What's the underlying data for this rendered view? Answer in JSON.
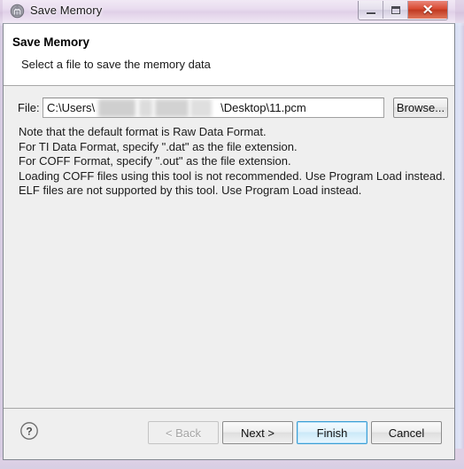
{
  "titlebar": {
    "icon": "app-icon",
    "title": "Save Memory",
    "minimize_label": "Minimize",
    "maximize_label": "Maximize",
    "close_label": "Close"
  },
  "header": {
    "title": "Save Memory",
    "subtitle": "Select a file to save the memory data"
  },
  "form": {
    "file_label": "File:",
    "file_value_prefix": "C:\\Users\\",
    "file_value_suffix": "\\Desktop\\11.pcm",
    "file_placeholder": "",
    "browse_label": "Browse..."
  },
  "notes": [
    "Note that the default format is Raw Data Format.",
    "For TI Data Format, specify \".dat\" as the file extension.",
    "For COFF Format, specify \".out\" as the file extension.",
    "Loading COFF files using this tool is not recommended. Use Program Load instead.",
    "ELF files are not supported by this tool. Use Program Load instead."
  ],
  "footer": {
    "help_label": "?",
    "back_label": "< Back",
    "next_label": "Next >",
    "finish_label": "Finish",
    "cancel_label": "Cancel"
  },
  "colors": {
    "titlebar": "#e9dcef",
    "dialog_body": "#efefef",
    "header_bg": "#ffffff",
    "close_button": "#d94a32",
    "default_button_border": "#3c9ed4",
    "disabled_text": "#a4a4a4"
  }
}
